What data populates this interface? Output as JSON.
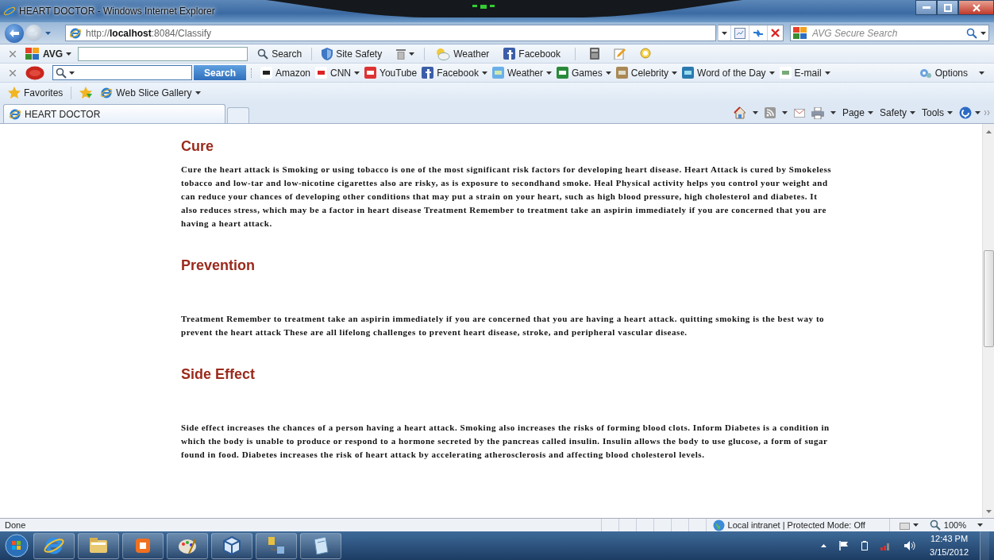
{
  "window": {
    "title": "HEART DOCTOR - Windows Internet Explorer"
  },
  "address_bar": {
    "url": "http://**localhost**:8084/Classify"
  },
  "search_box": {
    "placeholder": "AVG Secure Search"
  },
  "avg_toolbar": {
    "logo": "AVG",
    "search_button": "Search",
    "items": [
      "Site Safety",
      "Weather",
      "Facebook"
    ]
  },
  "ask_toolbar": {
    "search_button": "Search",
    "links": [
      {
        "label": "Amazon",
        "has_menu": false
      },
      {
        "label": "CNN",
        "has_menu": true
      },
      {
        "label": "YouTube",
        "has_menu": false
      },
      {
        "label": "Facebook",
        "has_menu": true
      },
      {
        "label": "Weather",
        "has_menu": true
      },
      {
        "label": "Games",
        "has_menu": true
      },
      {
        "label": "Celebrity",
        "has_menu": true
      },
      {
        "label": "Word of the Day",
        "has_menu": true
      },
      {
        "label": "E-mail",
        "has_menu": true
      }
    ],
    "options": "Options"
  },
  "favorites_bar": {
    "favorites": "Favorites",
    "items": [
      "Web Slice Gallery"
    ]
  },
  "tabs": [
    {
      "label": "HEART DOCTOR",
      "selected": true
    }
  ],
  "command_bar": [
    "Page",
    "Safety",
    "Tools"
  ],
  "sections": [
    {
      "heading": "Cure",
      "text": "Cure the heart attack is Smoking or using tobacco is one of the most significant risk factors for developing heart disease. Heart Attack is cured by Smokeless tobacco and low-tar and low-nicotine cigarettes also are risky, as is exposure to secondhand smoke. Heal Physical activity helps you control your weight and can reduce your chances of developing other conditions that may put a strain on your heart, such as high blood pressure, high cholesterol and diabetes. It also reduces stress, which may be a factor in heart disease Treatment Remember to treatment take an aspirin immediately if you are concerned that you are having a heart attack."
    },
    {
      "heading": "Prevention",
      "text": "Treatment Remember to treatment take an aspirin immediately if you are concerned that you are having a heart attack. quitting smoking is the best way to prevent the heart attack These are all lifelong challenges to prevent heart disease, stroke, and peripheral vascular disease."
    },
    {
      "heading": "Side Effect",
      "text": "Side effect increases the chances of a person having a heart attack. Smoking also increases the risks of forming blood clots. Inform Diabetes is a condition in which the body is unable to produce or respond to a hormone secreted by the pancreas called insulin. Insulin allows the body to use glucose, a form of sugar found in food. Diabetes increases the risk of heart attack by accelerating atherosclerosis and affecting blood cholesterol levels."
    }
  ],
  "status_bar": {
    "status": "Done",
    "zone": "Local intranet | Protected Mode: Off",
    "zoom": "100%"
  },
  "taskbar": {
    "time": "12:43 PM",
    "date": "3/15/2012"
  }
}
